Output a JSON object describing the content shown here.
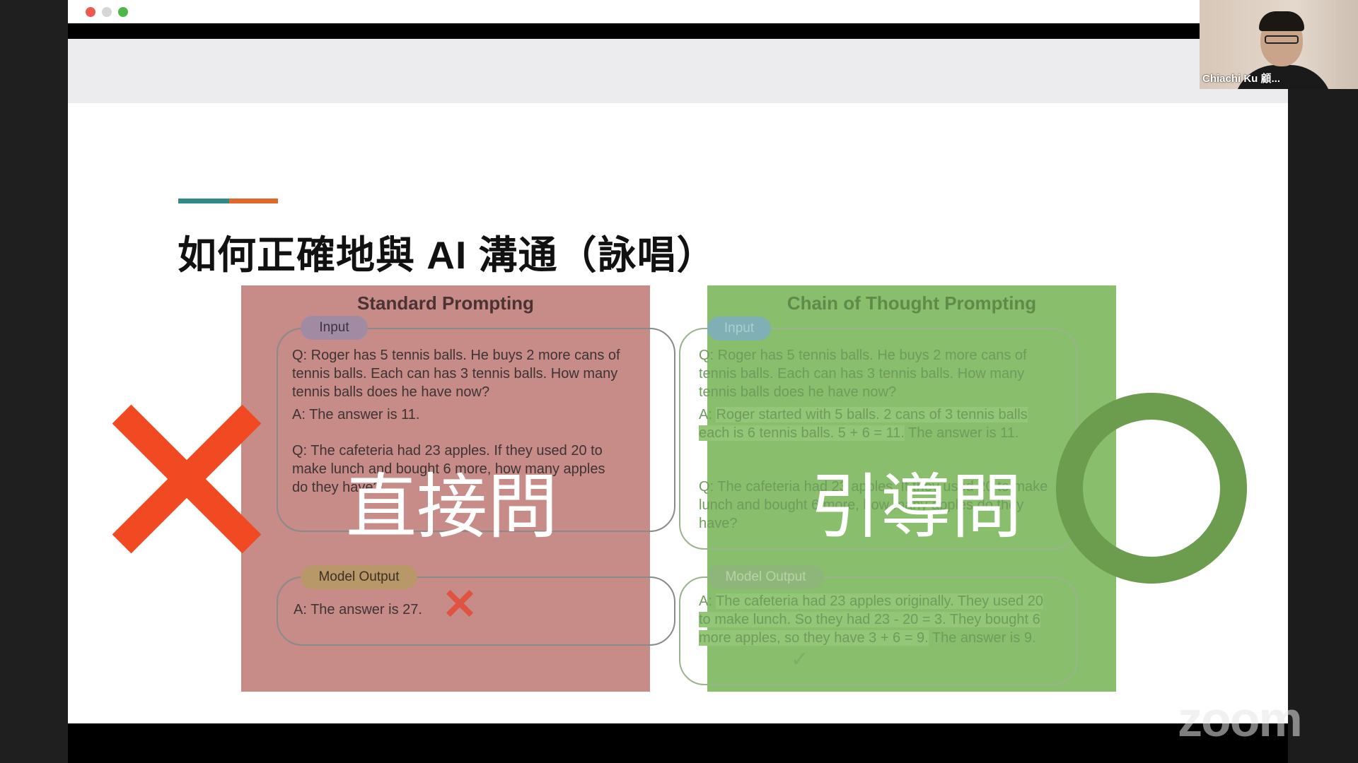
{
  "slide": {
    "heading": "如何正確地與 AI 溝通（詠唱）",
    "left_overlay": "直接問",
    "right_overlay": "引導問"
  },
  "standard": {
    "title": "Standard Prompting",
    "input_label": "Input",
    "q1": "Q: Roger has 5 tennis balls. He buys 2 more cans of tennis balls. Each can has 3 tennis balls. How many tennis balls does he have now?",
    "a1": "A: The answer is 11.",
    "q2_lines": [
      "Q: The cafeteria had 23 apples. If they used 20 to",
      "make lunch and bought 6 more, how many apples",
      "do they have?"
    ],
    "output_label": "Model Output",
    "output": "A: The answer is 27."
  },
  "cot": {
    "title": "Chain of Thought Prompting",
    "input_label": "Input",
    "q1": "Q: Roger has 5 tennis balls. He buys 2 more cans of tennis balls. Each can has 3 tennis balls. How many tennis balls does he have now?",
    "a1_prefix": "A: ",
    "a1_reasoning": "Roger started with 5 balls. 2 cans of 3 tennis balls each is 6 tennis balls. 5 + 6 = 11.",
    "a1_suffix": " The answer is 11.",
    "q2": "Q: The cafeteria had 23 apples. If they used 20 to make lunch and bought 6 more, how many apples do they have?",
    "output_label": "Model Output",
    "out_prefix": "A: ",
    "out_reasoning": "The cafeteria had 23 apples originally. They used 20 to make lunch. So they had 23 - 20 = 3. They bought 6 more apples, so they have 3 + 6 = 9.",
    "out_suffix": " The answer is 9."
  },
  "participant": {
    "name": "Chiachi Ku 顧..."
  },
  "watermark": "zoom",
  "colors": {
    "standard_panel": "#c78b88",
    "cot_panel": "#88be6c",
    "cross": "#f14a22",
    "ring": "#6c9c4e"
  }
}
